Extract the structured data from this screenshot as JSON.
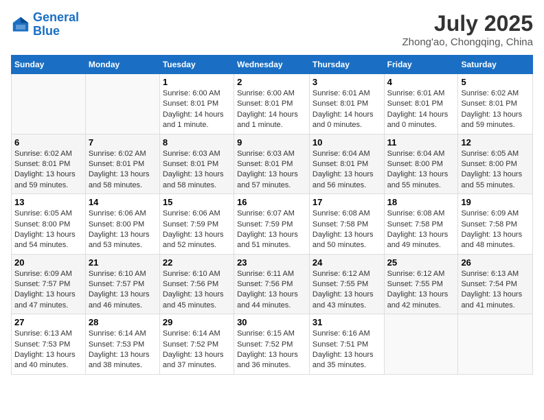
{
  "header": {
    "logo_line1": "General",
    "logo_line2": "Blue",
    "month_year": "July 2025",
    "location": "Zhong'ao, Chongqing, China"
  },
  "weekdays": [
    "Sunday",
    "Monday",
    "Tuesday",
    "Wednesday",
    "Thursday",
    "Friday",
    "Saturday"
  ],
  "weeks": [
    [
      {
        "day": "",
        "info": ""
      },
      {
        "day": "",
        "info": ""
      },
      {
        "day": "1",
        "info": "Sunrise: 6:00 AM\nSunset: 8:01 PM\nDaylight: 14 hours and 1 minute."
      },
      {
        "day": "2",
        "info": "Sunrise: 6:00 AM\nSunset: 8:01 PM\nDaylight: 14 hours and 1 minute."
      },
      {
        "day": "3",
        "info": "Sunrise: 6:01 AM\nSunset: 8:01 PM\nDaylight: 14 hours and 0 minutes."
      },
      {
        "day": "4",
        "info": "Sunrise: 6:01 AM\nSunset: 8:01 PM\nDaylight: 14 hours and 0 minutes."
      },
      {
        "day": "5",
        "info": "Sunrise: 6:02 AM\nSunset: 8:01 PM\nDaylight: 13 hours and 59 minutes."
      }
    ],
    [
      {
        "day": "6",
        "info": "Sunrise: 6:02 AM\nSunset: 8:01 PM\nDaylight: 13 hours and 59 minutes."
      },
      {
        "day": "7",
        "info": "Sunrise: 6:02 AM\nSunset: 8:01 PM\nDaylight: 13 hours and 58 minutes."
      },
      {
        "day": "8",
        "info": "Sunrise: 6:03 AM\nSunset: 8:01 PM\nDaylight: 13 hours and 58 minutes."
      },
      {
        "day": "9",
        "info": "Sunrise: 6:03 AM\nSunset: 8:01 PM\nDaylight: 13 hours and 57 minutes."
      },
      {
        "day": "10",
        "info": "Sunrise: 6:04 AM\nSunset: 8:01 PM\nDaylight: 13 hours and 56 minutes."
      },
      {
        "day": "11",
        "info": "Sunrise: 6:04 AM\nSunset: 8:00 PM\nDaylight: 13 hours and 55 minutes."
      },
      {
        "day": "12",
        "info": "Sunrise: 6:05 AM\nSunset: 8:00 PM\nDaylight: 13 hours and 55 minutes."
      }
    ],
    [
      {
        "day": "13",
        "info": "Sunrise: 6:05 AM\nSunset: 8:00 PM\nDaylight: 13 hours and 54 minutes."
      },
      {
        "day": "14",
        "info": "Sunrise: 6:06 AM\nSunset: 8:00 PM\nDaylight: 13 hours and 53 minutes."
      },
      {
        "day": "15",
        "info": "Sunrise: 6:06 AM\nSunset: 7:59 PM\nDaylight: 13 hours and 52 minutes."
      },
      {
        "day": "16",
        "info": "Sunrise: 6:07 AM\nSunset: 7:59 PM\nDaylight: 13 hours and 51 minutes."
      },
      {
        "day": "17",
        "info": "Sunrise: 6:08 AM\nSunset: 7:58 PM\nDaylight: 13 hours and 50 minutes."
      },
      {
        "day": "18",
        "info": "Sunrise: 6:08 AM\nSunset: 7:58 PM\nDaylight: 13 hours and 49 minutes."
      },
      {
        "day": "19",
        "info": "Sunrise: 6:09 AM\nSunset: 7:58 PM\nDaylight: 13 hours and 48 minutes."
      }
    ],
    [
      {
        "day": "20",
        "info": "Sunrise: 6:09 AM\nSunset: 7:57 PM\nDaylight: 13 hours and 47 minutes."
      },
      {
        "day": "21",
        "info": "Sunrise: 6:10 AM\nSunset: 7:57 PM\nDaylight: 13 hours and 46 minutes."
      },
      {
        "day": "22",
        "info": "Sunrise: 6:10 AM\nSunset: 7:56 PM\nDaylight: 13 hours and 45 minutes."
      },
      {
        "day": "23",
        "info": "Sunrise: 6:11 AM\nSunset: 7:56 PM\nDaylight: 13 hours and 44 minutes."
      },
      {
        "day": "24",
        "info": "Sunrise: 6:12 AM\nSunset: 7:55 PM\nDaylight: 13 hours and 43 minutes."
      },
      {
        "day": "25",
        "info": "Sunrise: 6:12 AM\nSunset: 7:55 PM\nDaylight: 13 hours and 42 minutes."
      },
      {
        "day": "26",
        "info": "Sunrise: 6:13 AM\nSunset: 7:54 PM\nDaylight: 13 hours and 41 minutes."
      }
    ],
    [
      {
        "day": "27",
        "info": "Sunrise: 6:13 AM\nSunset: 7:53 PM\nDaylight: 13 hours and 40 minutes."
      },
      {
        "day": "28",
        "info": "Sunrise: 6:14 AM\nSunset: 7:53 PM\nDaylight: 13 hours and 38 minutes."
      },
      {
        "day": "29",
        "info": "Sunrise: 6:14 AM\nSunset: 7:52 PM\nDaylight: 13 hours and 37 minutes."
      },
      {
        "day": "30",
        "info": "Sunrise: 6:15 AM\nSunset: 7:52 PM\nDaylight: 13 hours and 36 minutes."
      },
      {
        "day": "31",
        "info": "Sunrise: 6:16 AM\nSunset: 7:51 PM\nDaylight: 13 hours and 35 minutes."
      },
      {
        "day": "",
        "info": ""
      },
      {
        "day": "",
        "info": ""
      }
    ]
  ]
}
